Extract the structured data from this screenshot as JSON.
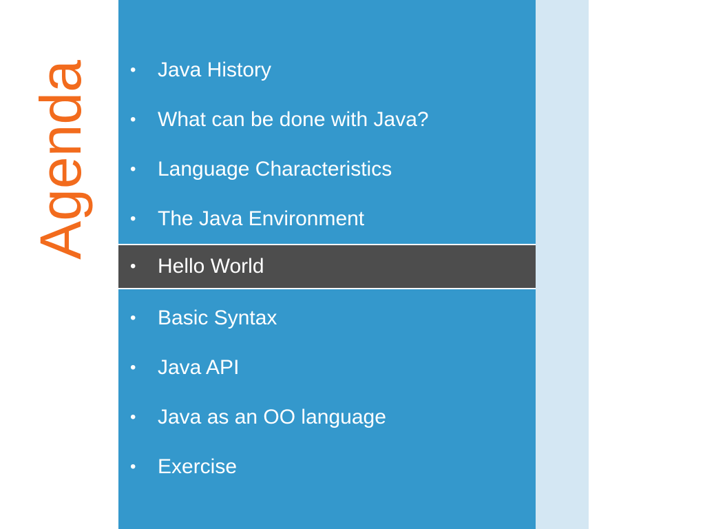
{
  "title": "Agenda",
  "items": [
    {
      "label": "Java History",
      "active": false
    },
    {
      "label": "What can be done with Java?",
      "active": false
    },
    {
      "label": "Language Characteristics",
      "active": false
    },
    {
      "label": "The Java Environment",
      "active": false
    },
    {
      "label": "Hello World",
      "active": true
    },
    {
      "label": "Basic Syntax",
      "active": false
    },
    {
      "label": "Java API",
      "active": false
    },
    {
      "label": "Java as an OO language",
      "active": false
    },
    {
      "label": "Exercise",
      "active": false
    }
  ],
  "bullet": "•",
  "colors": {
    "title": "#f26b1d",
    "panel": "#3498cc",
    "highlight": "#4d4d4d",
    "strip": "#d4e7f3"
  }
}
